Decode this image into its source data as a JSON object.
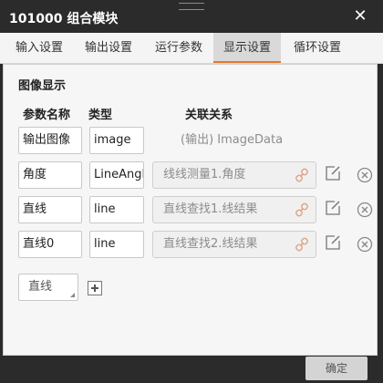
{
  "window": {
    "title": "101000 组合模块",
    "close_glyph": "✕"
  },
  "tabs": [
    {
      "label": "输入设置",
      "active": false
    },
    {
      "label": "输出设置",
      "active": false
    },
    {
      "label": "运行参数",
      "active": false
    },
    {
      "label": "显示设置",
      "active": true
    },
    {
      "label": "循环设置",
      "active": false
    }
  ],
  "section": {
    "title": "图像显示",
    "columns": {
      "name": "参数名称",
      "type": "类型",
      "relation": "关联关系"
    }
  },
  "rows": [
    {
      "name": "输出图像",
      "type": "image",
      "relation": "(输出) ImageData"
    },
    {
      "name": "角度",
      "type": "LineAngle",
      "relation": "线线测量1.角度"
    },
    {
      "name": "直线",
      "type": "line",
      "relation": "直线查找1.线结果"
    },
    {
      "name": "直线0",
      "type": "line",
      "relation": "直线查找2.线结果"
    }
  ],
  "add_type_select": {
    "value": "直线"
  },
  "footer": {
    "ok_label": "确定"
  },
  "colors": {
    "accent": "#e8752a",
    "titlebar": "#2b2b2b",
    "link_icon": "#e0a080"
  },
  "icons": [
    "link-icon",
    "edit-icon",
    "delete-circle-icon",
    "add-icon",
    "close-icon"
  ]
}
